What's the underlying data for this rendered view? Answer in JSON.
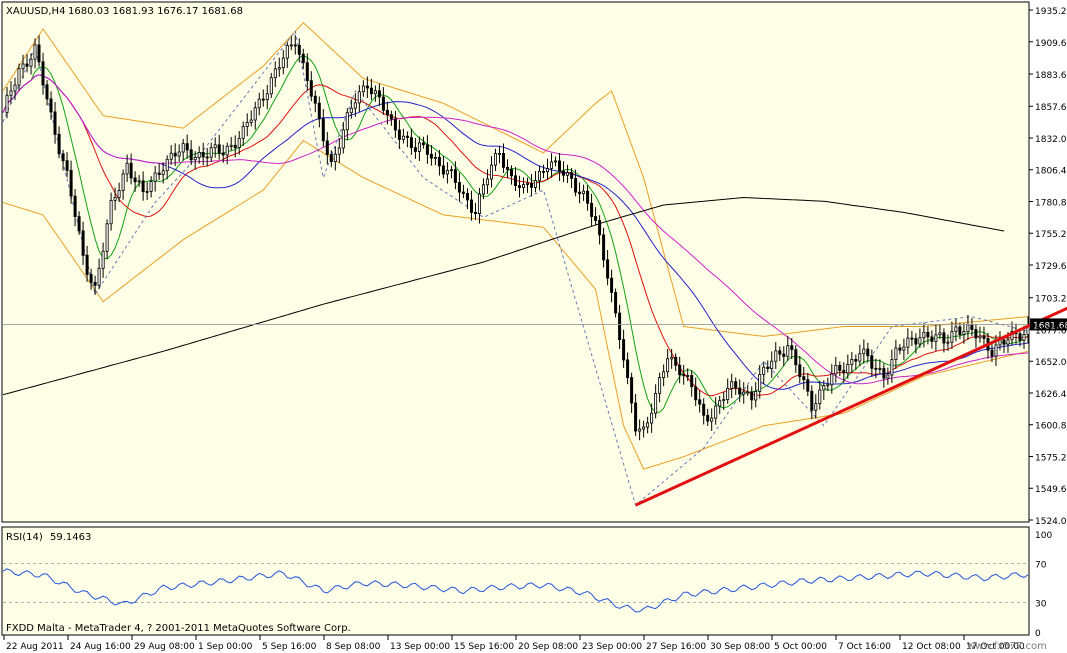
{
  "header": {
    "symbol_label": "XAUUSD,H4",
    "ohlc_text": "1680.03 1681.93 1676.17 1681.68"
  },
  "rsi_panel": {
    "label": "RSI(14)",
    "value_text": "59.1463"
  },
  "footer": {
    "credit": "FXDD Malta - MetaTrader 4, ? 2001-2011 MetaQuotes Software Corp.",
    "watermark": "www.fx577.com"
  },
  "current_price_tag": "1681.68",
  "colors": {
    "background": "#FFFFFF",
    "panel_background": "#FFFFE8",
    "candle": "#000000",
    "ma_green": "#11A011",
    "ma_red": "#DD1111",
    "ma_blue": "#2222CC",
    "ma_magenta": "#CC22CC",
    "ma_black": "#000000",
    "bollinger": "#E8A020",
    "rsi_line": "#2255DD",
    "trendline": "#E01010",
    "zigzag": "#6677BB"
  },
  "chart_data": {
    "type": "candlestick",
    "title": "XAUUSD,H4",
    "price_axis_ticks": [
      1935.2,
      1909.6,
      1883.6,
      1857.6,
      1832.0,
      1806.4,
      1780.8,
      1755.2,
      1729.6,
      1703.2,
      1677.6,
      1652.0,
      1626.4,
      1600.8,
      1575.2,
      1549.6,
      1524.0
    ],
    "ylim": [
      1524.0,
      1935.2
    ],
    "time_axis_labels": [
      "22 Aug 2011",
      "24 Aug 16:00",
      "29 Aug 08:00",
      "1 Sep 00:00",
      "5 Sep 16:00",
      "8 Sep 08:00",
      "13 Sep 00:00",
      "15 Sep 16:00",
      "20 Sep 08:00",
      "23 Sep 00:00",
      "27 Sep 16:00",
      "30 Sep 08:00",
      "5 Oct 00:00",
      "7 Oct 16:00",
      "12 Oct 08:00",
      "17 Oct 00:00"
    ],
    "price_path": [
      [
        0,
        1850
      ],
      [
        4,
        1888
      ],
      [
        8,
        1902
      ],
      [
        12,
        1850
      ],
      [
        16,
        1802
      ],
      [
        20,
        1735
      ],
      [
        23,
        1712
      ],
      [
        27,
        1775
      ],
      [
        31,
        1812
      ],
      [
        35,
        1785
      ],
      [
        40,
        1812
      ],
      [
        45,
        1822
      ],
      [
        50,
        1818
      ],
      [
        55,
        1822
      ],
      [
        60,
        1835
      ],
      [
        65,
        1868
      ],
      [
        70,
        1895
      ],
      [
        73,
        1913
      ],
      [
        76,
        1880
      ],
      [
        79,
        1842
      ],
      [
        82,
        1812
      ],
      [
        85,
        1838
      ],
      [
        88,
        1862
      ],
      [
        91,
        1878
      ],
      [
        94,
        1862
      ],
      [
        97,
        1842
      ],
      [
        100,
        1835
      ],
      [
        103,
        1822
      ],
      [
        106,
        1822
      ],
      [
        109,
        1812
      ],
      [
        112,
        1800
      ],
      [
        115,
        1785
      ],
      [
        118,
        1775
      ],
      [
        121,
        1800
      ],
      [
        124,
        1822
      ],
      [
        127,
        1800
      ],
      [
        130,
        1788
      ],
      [
        133,
        1800
      ],
      [
        136,
        1812
      ],
      [
        139,
        1805
      ],
      [
        142,
        1800
      ],
      [
        145,
        1785
      ],
      [
        148,
        1762
      ],
      [
        151,
        1725
      ],
      [
        154,
        1672
      ],
      [
        156,
        1632
      ],
      [
        158,
        1600
      ],
      [
        160,
        1598
      ],
      [
        163,
        1622
      ],
      [
        166,
        1655
      ],
      [
        169,
        1648
      ],
      [
        172,
        1630
      ],
      [
        175,
        1605
      ],
      [
        178,
        1615
      ],
      [
        181,
        1628
      ],
      [
        184,
        1630
      ],
      [
        187,
        1625
      ],
      [
        190,
        1642
      ],
      [
        193,
        1658
      ],
      [
        196,
        1665
      ],
      [
        199,
        1640
      ],
      [
        202,
        1618
      ],
      [
        205,
        1632
      ],
      [
        208,
        1642
      ],
      [
        211,
        1650
      ],
      [
        214,
        1660
      ],
      [
        217,
        1648
      ],
      [
        220,
        1642
      ],
      [
        223,
        1658
      ],
      [
        226,
        1666
      ],
      [
        229,
        1675
      ],
      [
        232,
        1670
      ],
      [
        235,
        1668
      ],
      [
        238,
        1680
      ],
      [
        241,
        1675
      ],
      [
        244,
        1672
      ],
      [
        247,
        1662
      ],
      [
        250,
        1666
      ],
      [
        253,
        1674
      ],
      [
        256,
        1678
      ]
    ],
    "zigzag": [
      [
        0,
        1845
      ],
      [
        8,
        1905
      ],
      [
        23,
        1706
      ],
      [
        38,
        1780
      ],
      [
        50,
        1822
      ],
      [
        73,
        1918
      ],
      [
        80,
        1800
      ],
      [
        88,
        1870
      ],
      [
        105,
        1800
      ],
      [
        120,
        1768
      ],
      [
        135,
        1790
      ],
      [
        158,
        1536
      ],
      [
        175,
        1582
      ],
      [
        190,
        1652
      ],
      [
        205,
        1600
      ],
      [
        222,
        1680
      ],
      [
        242,
        1688
      ],
      [
        256,
        1676
      ]
    ],
    "trendline": [
      [
        158,
        1536
      ],
      [
        266,
        1695
      ]
    ],
    "ma_black_200": [
      [
        0,
        1625
      ],
      [
        40,
        1660
      ],
      [
        80,
        1698
      ],
      [
        120,
        1732
      ],
      [
        150,
        1764
      ],
      [
        165,
        1778
      ],
      [
        185,
        1784
      ],
      [
        205,
        1781
      ],
      [
        225,
        1772
      ],
      [
        250,
        1757
      ]
    ],
    "bollinger_upper_points": [
      [
        0,
        1870
      ],
      [
        10,
        1920
      ],
      [
        25,
        1850
      ],
      [
        45,
        1840
      ],
      [
        65,
        1890
      ],
      [
        75,
        1925
      ],
      [
        90,
        1880
      ],
      [
        110,
        1860
      ],
      [
        135,
        1820
      ],
      [
        148,
        1860
      ],
      [
        152,
        1870
      ],
      [
        160,
        1800
      ],
      [
        170,
        1680
      ],
      [
        190,
        1672
      ],
      [
        210,
        1680
      ],
      [
        230,
        1680
      ],
      [
        256,
        1688
      ]
    ],
    "bollinger_lower_points": [
      [
        0,
        1780
      ],
      [
        10,
        1770
      ],
      [
        25,
        1700
      ],
      [
        45,
        1750
      ],
      [
        65,
        1790
      ],
      [
        75,
        1830
      ],
      [
        90,
        1800
      ],
      [
        110,
        1770
      ],
      [
        135,
        1760
      ],
      [
        148,
        1710
      ],
      [
        155,
        1600
      ],
      [
        160,
        1565
      ],
      [
        170,
        1575
      ],
      [
        190,
        1600
      ],
      [
        210,
        1610
      ],
      [
        230,
        1640
      ],
      [
        256,
        1660
      ]
    ],
    "rsi": {
      "ylim": [
        0,
        100
      ],
      "ticks": [
        100,
        70,
        30,
        0
      ],
      "levels": [
        70,
        30
      ],
      "values": [
        [
          0,
          62
        ],
        [
          10,
          58
        ],
        [
          20,
          40
        ],
        [
          30,
          28
        ],
        [
          40,
          45
        ],
        [
          55,
          52
        ],
        [
          70,
          60
        ],
        [
          80,
          42
        ],
        [
          90,
          50
        ],
        [
          100,
          48
        ],
        [
          115,
          42
        ],
        [
          125,
          46
        ],
        [
          135,
          48
        ],
        [
          145,
          40
        ],
        [
          155,
          25
        ],
        [
          160,
          22
        ],
        [
          170,
          38
        ],
        [
          185,
          45
        ],
        [
          200,
          52
        ],
        [
          215,
          56
        ],
        [
          230,
          60
        ],
        [
          245,
          55
        ],
        [
          256,
          59
        ]
      ]
    }
  }
}
